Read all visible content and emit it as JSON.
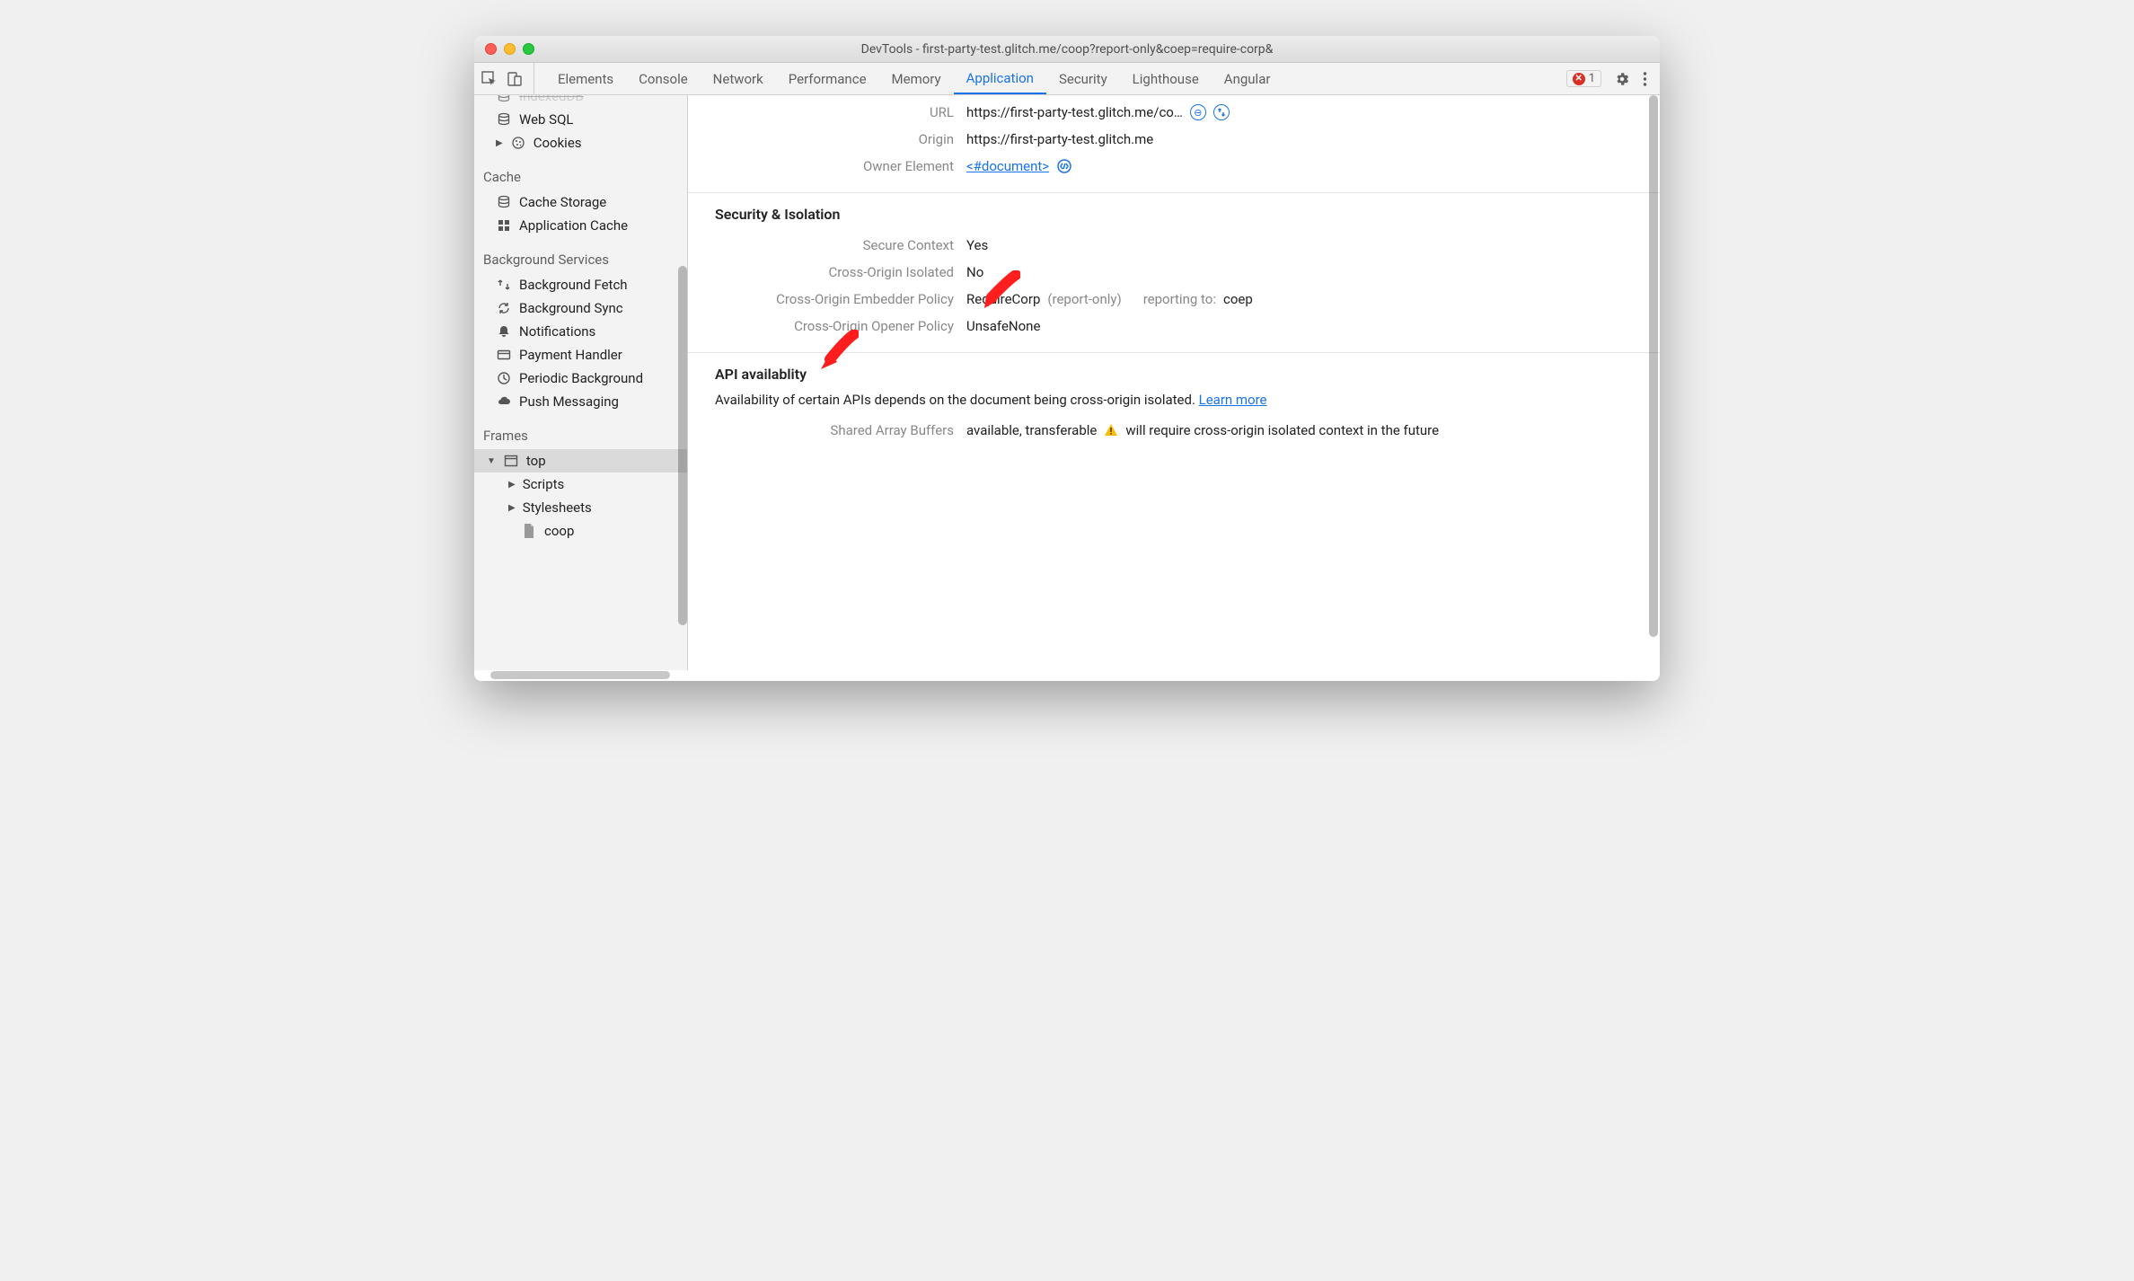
{
  "window": {
    "title": "DevTools - first-party-test.glitch.me/coop?report-only&coep=require-corp&"
  },
  "tabs": {
    "elements": "Elements",
    "console": "Console",
    "network": "Network",
    "performance": "Performance",
    "memory": "Memory",
    "application": "Application",
    "security": "Security",
    "lighthouse": "Lighthouse",
    "angular": "Angular"
  },
  "errors": {
    "count": "1"
  },
  "sidebar": {
    "indexeddb": "IndexedDB",
    "websql": "Web SQL",
    "cookies": "Cookies",
    "cache_title": "Cache",
    "cache_storage": "Cache Storage",
    "app_cache": "Application Cache",
    "bg_title": "Background Services",
    "bg_fetch": "Background Fetch",
    "bg_sync": "Background Sync",
    "notifications": "Notifications",
    "payment": "Payment Handler",
    "periodic": "Periodic Background",
    "push": "Push Messaging",
    "frames_title": "Frames",
    "top": "top",
    "scripts": "Scripts",
    "stylesheets": "Stylesheets",
    "coop": "coop"
  },
  "doc": {
    "url_label": "URL",
    "url_value": "https://first-party-test.glitch.me/co…",
    "origin_label": "Origin",
    "origin_value": "https://first-party-test.glitch.me",
    "owner_label": "Owner Element",
    "owner_value": "<#document>"
  },
  "security": {
    "title": "Security & Isolation",
    "secure_label": "Secure Context",
    "secure_value": "Yes",
    "coi_label": "Cross-Origin Isolated",
    "coi_value": "No",
    "coep_label": "Cross-Origin Embedder Policy",
    "coep_value": "RequireCorp",
    "coep_mode": "(report-only)",
    "coep_reporting_label": "reporting to:",
    "coep_reporting_value": "coep",
    "coop_label": "Cross-Origin Opener Policy",
    "coop_value": "UnsafeNone"
  },
  "api": {
    "title": "API availablity",
    "desc": "Availability of certain APIs depends on the document being cross-origin isolated. ",
    "learn": "Learn more",
    "sab_label": "Shared Array Buffers",
    "sab_value": "available, transferable",
    "sab_warn": "will require cross-origin isolated context in the future"
  }
}
